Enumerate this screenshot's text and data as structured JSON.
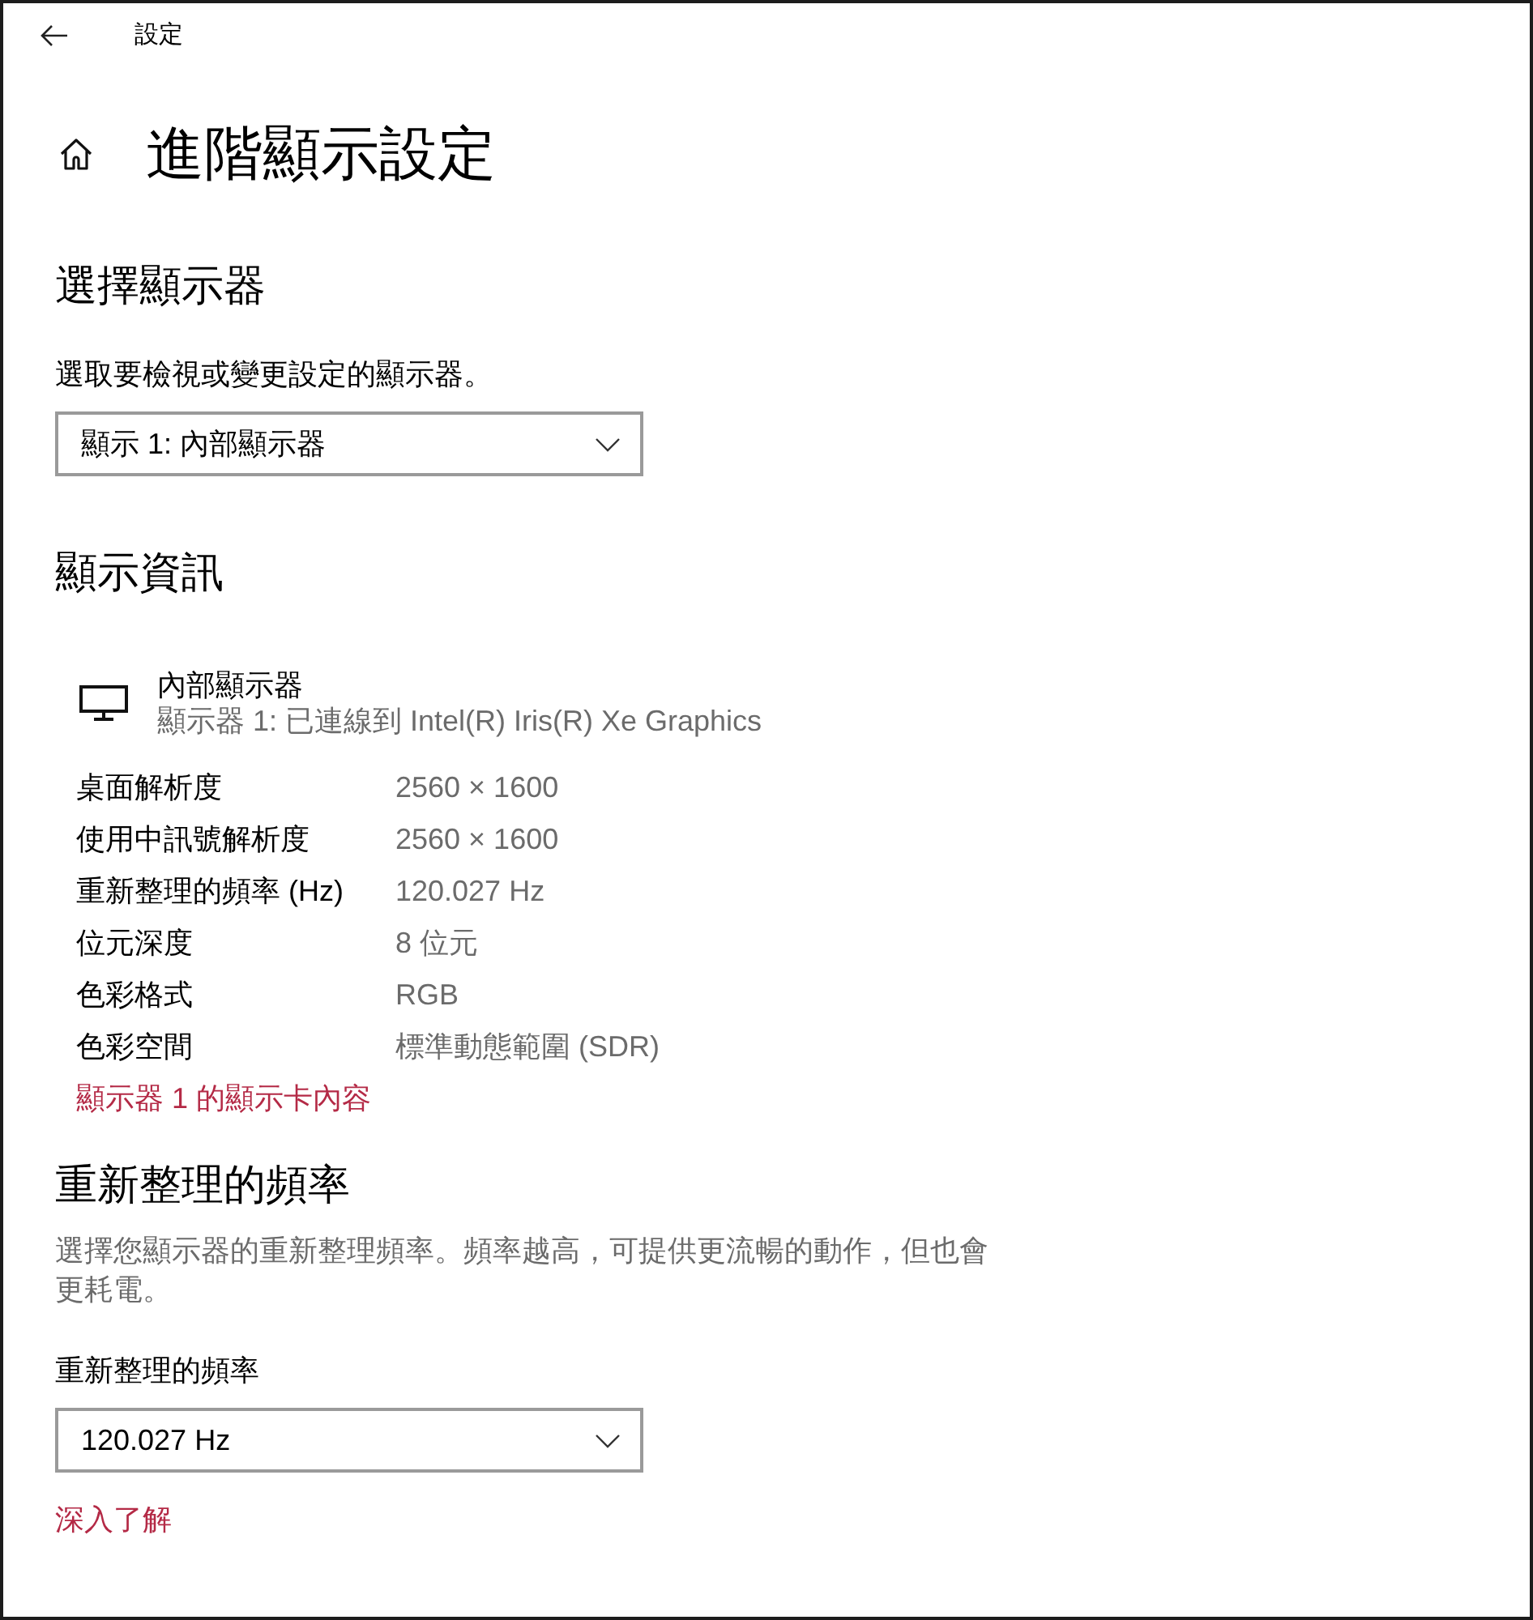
{
  "window": {
    "title": "設定"
  },
  "page": {
    "title": "進階顯示設定"
  },
  "choose_display": {
    "heading": "選擇顯示器",
    "label": "選取要檢視或變更設定的顯示器。",
    "dropdown": {
      "value": "顯示 1: 內部顯示器"
    }
  },
  "display_info": {
    "heading": "顯示資訊",
    "device": {
      "name": "內部顯示器",
      "description": "顯示器 1: 已連線到 Intel(R) Iris(R) Xe Graphics"
    },
    "rows": [
      {
        "label": "桌面解析度",
        "value": "2560 × 1600"
      },
      {
        "label": "使用中訊號解析度",
        "value": "2560 × 1600"
      },
      {
        "label": "重新整理的頻率 (Hz)",
        "value": "120.027 Hz"
      },
      {
        "label": "位元深度",
        "value": "8 位元"
      },
      {
        "label": "色彩格式",
        "value": "RGB"
      },
      {
        "label": "色彩空間",
        "value": "標準動態範圍 (SDR)"
      }
    ],
    "link": "顯示器 1 的顯示卡內容"
  },
  "refresh_rate": {
    "heading": "重新整理的頻率",
    "description": "選擇您顯示器的重新整理頻率。頻率越高，可提供更流暢的動作，但也會更耗電。",
    "label": "重新整理的頻率",
    "dropdown": {
      "value": "120.027 Hz"
    },
    "link": "深入了解"
  }
}
